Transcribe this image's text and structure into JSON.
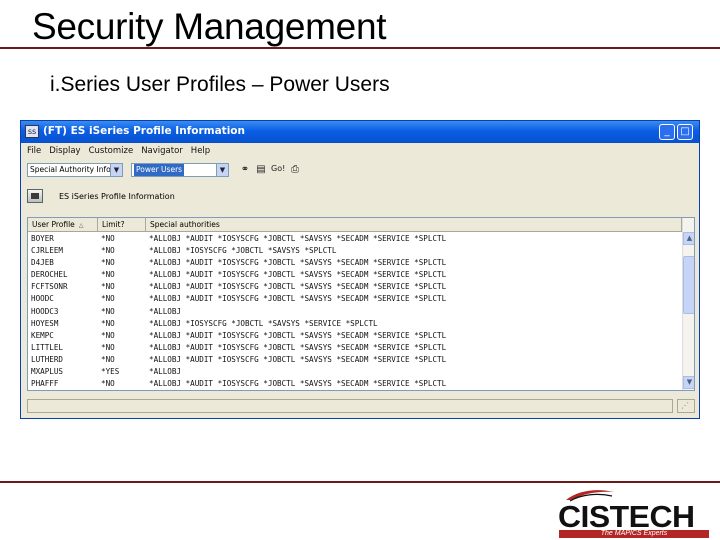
{
  "slide": {
    "title": "Security Management",
    "subtitle": "i.Series User Profiles – Power Users"
  },
  "window": {
    "icon_label": "ss",
    "title": "(FT) ES iSeries Profile Information",
    "buttons": {
      "minimize": "_",
      "maximize": "□"
    }
  },
  "menu": [
    "File",
    "Display",
    "Customize",
    "Navigator",
    "Help"
  ],
  "toolbar": {
    "filter_combo": "Special Authority Info",
    "group_combo": "Power Users",
    "go_label": "Go!"
  },
  "panel": {
    "title": "ES iSeries Profile Information"
  },
  "table": {
    "headers": [
      "User Profile",
      "Limit?",
      "Special authorities"
    ],
    "rows": [
      [
        "BOYER",
        "*NO",
        "*ALLOBJ  *AUDIT  *IOSYSCFG *JOBCTL  *SAVSYS  *SECADM  *SERVICE *SPLCTL"
      ],
      [
        "CJRLEEM",
        "*NO",
        "*ALLOBJ  *IOSYSCFG *JOBCTL  *SAVSYS  *SPLCTL"
      ],
      [
        "D4JEB",
        "*NO",
        "*ALLOBJ  *AUDIT  *IOSYSCFG *JOBCTL  *SAVSYS  *SECADM  *SERVICE *SPLCTL"
      ],
      [
        "DEROCHEL",
        "*NO",
        "*ALLOBJ  *AUDIT  *IOSYSCFG *JOBCTL  *SAVSYS  *SECADM  *SERVICE *SPLCTL"
      ],
      [
        "FCFTSONR",
        "*NO",
        "*ALLOBJ  *AUDIT  *IOSYSCFG *JOBCTL  *SAVSYS  *SECADM  *SERVICE *SPLCTL"
      ],
      [
        "HOODC",
        "*NO",
        "*ALLOBJ  *AUDIT  *IOSYSCFG *JOBCTL  *SAVSYS  *SECADM  *SERVICE *SPLCTL"
      ],
      [
        "HOODC3",
        "*NO",
        "*ALLOBJ"
      ],
      [
        "HOYESM",
        "*NO",
        "*ALLOBJ  *IOSYSCFG *JOBCTL  *SAVSYS  *SERVICE *SPLCTL"
      ],
      [
        "KEMPC",
        "*NO",
        "*ALLOBJ  *AUDIT  *IOSYSCFG *JOBCTL  *SAVSYS  *SECADM  *SERVICE *SPLCTL"
      ],
      [
        "LITTLEL",
        "*NO",
        "*ALLOBJ  *AUDIT  *IOSYSCFG *JOBCTL  *SAVSYS  *SECADM  *SERVICE *SPLCTL"
      ],
      [
        "LUTHERD",
        "*NO",
        "*ALLOBJ  *AUDIT  *IOSYSCFG *JOBCTL  *SAVSYS  *SECADM  *SERVICE *SPLCTL"
      ],
      [
        "MXAPLUS",
        "*YES",
        "*ALLOBJ"
      ],
      [
        "PHAFFF",
        "*NO",
        "*ALLOBJ  *AUDIT  *IOSYSCFG *JOBCTL  *SAVSYS  *SECADM  *SERVICE *SPLCTL"
      ]
    ]
  },
  "logo": {
    "name": "CISTECH",
    "tagline": "The MAPICS Experts",
    "accent_color": "#b32626"
  },
  "colors": {
    "titlebar": "#0a5ee4",
    "rule": "#6b1a1a",
    "selection": "#316ac5"
  },
  "icons": [
    "binoculars-icon",
    "filter-icon",
    "go-icon",
    "printer-icon"
  ]
}
